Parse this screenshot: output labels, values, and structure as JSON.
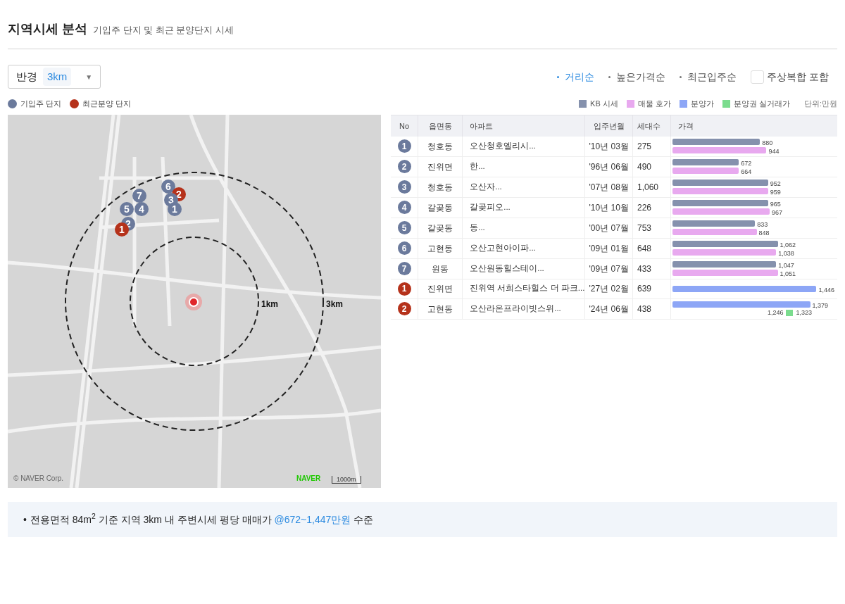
{
  "header": {
    "title": "지역시세 분석",
    "subtitle": "기입주 단지 및 최근 분양단지 시세"
  },
  "radius_select": {
    "label": "반경",
    "value": "3km",
    "caret": "▼"
  },
  "sort_options": [
    {
      "label": "거리순",
      "selected": true
    },
    {
      "label": "높은가격순",
      "selected": false
    },
    {
      "label": "최근입주순",
      "selected": false
    }
  ],
  "mixed_use_checkbox": {
    "label": "주상복합 포함",
    "checked": false
  },
  "map_legend": [
    {
      "label": "기입주 단지",
      "color": "#6b7a9c"
    },
    {
      "label": "최근분양 단지",
      "color": "#b5321b"
    }
  ],
  "map": {
    "markers": [
      {
        "kind": "existing",
        "number": "6"
      },
      {
        "kind": "existing",
        "number": "7"
      },
      {
        "kind": "presale",
        "number": "2"
      },
      {
        "kind": "existing",
        "number": "3"
      },
      {
        "kind": "existing",
        "number": "5"
      },
      {
        "kind": "existing",
        "number": "4"
      },
      {
        "kind": "existing",
        "number": "1"
      },
      {
        "kind": "existing",
        "number": "2"
      },
      {
        "kind": "presale",
        "number": "1"
      }
    ],
    "radius_labels": [
      "1km",
      "3km"
    ],
    "brand": "NAVER",
    "scale": "1000m",
    "copyright": "© NAVER Corp."
  },
  "price_legend": [
    {
      "label": "KB 시세",
      "color": "#8591ad"
    },
    {
      "label": "매물 호가",
      "color": "#e8a9ef"
    },
    {
      "label": "분양가",
      "color": "#8da6f6"
    },
    {
      "label": "분양권 실거래가",
      "color": "#7bdc8e"
    }
  ],
  "unit": "단위:만원",
  "table": {
    "columns": [
      "No",
      "읍면동",
      "아파트",
      "입주년월",
      "세대수",
      "가격"
    ],
    "rows": [
      {
        "kind": "existing",
        "no": "1",
        "dong": "청호동",
        "apartment": "오산청호엘리시...",
        "move_in": "'10년 03월",
        "units": "275",
        "bars": [
          {
            "kind": "kb",
            "level": 0.54,
            "label": "880"
          },
          {
            "kind": "asking",
            "level": 0.58,
            "label": "944"
          }
        ]
      },
      {
        "kind": "existing",
        "no": "2",
        "dong": "진위면",
        "apartment": "한...",
        "move_in": "'96년 06월",
        "units": "490",
        "bars": [
          {
            "kind": "kb",
            "level": 0.41,
            "label": "672"
          },
          {
            "kind": "asking",
            "level": 0.41,
            "label": "664"
          }
        ]
      },
      {
        "kind": "existing",
        "no": "3",
        "dong": "청호동",
        "apartment": "오산자...",
        "move_in": "'07년 08월",
        "units": "1,060",
        "bars": [
          {
            "kind": "kb",
            "level": 0.59,
            "label": "952"
          },
          {
            "kind": "asking",
            "level": 0.59,
            "label": "959"
          }
        ]
      },
      {
        "kind": "existing",
        "no": "4",
        "dong": "갈곶동",
        "apartment": "갈곶피오...",
        "move_in": "'10년 10월",
        "units": "226",
        "bars": [
          {
            "kind": "kb",
            "level": 0.59,
            "label": "965"
          },
          {
            "kind": "asking",
            "level": 0.6,
            "label": "967"
          }
        ]
      },
      {
        "kind": "existing",
        "no": "5",
        "dong": "갈곶동",
        "apartment": "동...",
        "move_in": "'00년 07월",
        "units": "753",
        "bars": [
          {
            "kind": "kb",
            "level": 0.51,
            "label": "833"
          },
          {
            "kind": "asking",
            "level": 0.52,
            "label": "848"
          }
        ]
      },
      {
        "kind": "existing",
        "no": "6",
        "dong": "고현동",
        "apartment": "오산고현아이파...",
        "move_in": "'09년 01월",
        "units": "648",
        "bars": [
          {
            "kind": "kb",
            "level": 0.65,
            "label": "1,062"
          },
          {
            "kind": "asking",
            "level": 0.64,
            "label": "1,038"
          }
        ]
      },
      {
        "kind": "existing",
        "no": "7",
        "dong": "원동",
        "apartment": "오산원동힐스테이...",
        "move_in": "'09년 07월",
        "units": "433",
        "bars": [
          {
            "kind": "kb",
            "level": 0.64,
            "label": "1,047"
          },
          {
            "kind": "asking",
            "level": 0.65,
            "label": "1,051"
          }
        ]
      },
      {
        "kind": "presale",
        "no": "1",
        "dong": "진위면",
        "apartment": "진위역 서희스타힐스 더 파크...",
        "move_in": "'27년 02월",
        "units": "639",
        "bars": [
          {
            "kind": "presale",
            "level": 0.89,
            "label": "1,446"
          }
        ]
      },
      {
        "kind": "presale",
        "no": "2",
        "dong": "고현동",
        "apartment": "오산라온프라이빗스위...",
        "move_in": "'24년 06월",
        "units": "438",
        "bars": [
          {
            "kind": "presale",
            "level": 0.85,
            "label": "1,379"
          },
          {
            "kind": "trade_range",
            "low": "1,246",
            "high": "1,323"
          }
        ]
      }
    ]
  },
  "summary": {
    "bullet": "•",
    "text": "전용면적 84m$^{2}$ 기준 지역 3km 내 주변시세 평당 매매가",
    "highlight": "@672~1,447만원",
    "suffix": "수준"
  }
}
